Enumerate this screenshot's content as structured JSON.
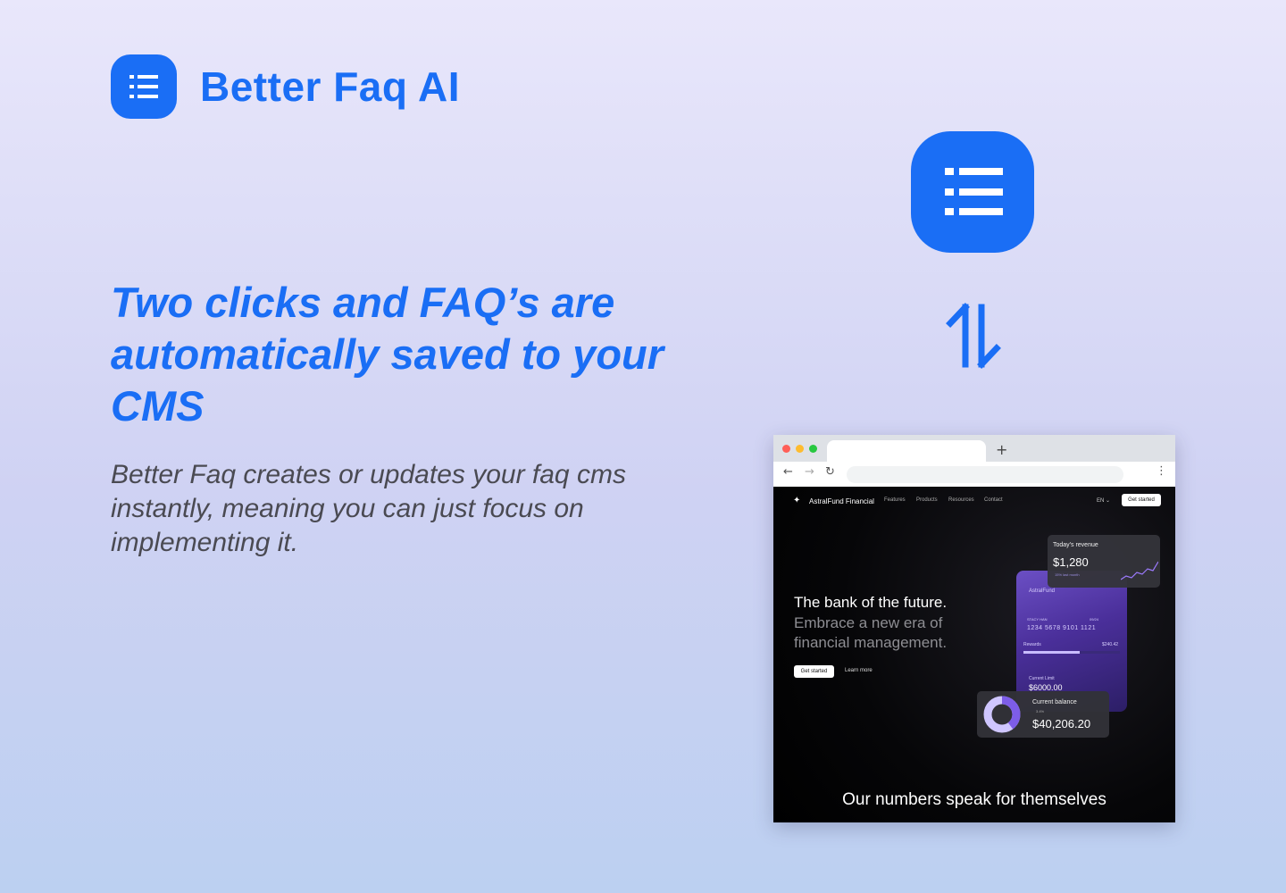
{
  "brand": {
    "name": "Better Faq AI",
    "icon": "list-icon",
    "color": "#1a6ef5"
  },
  "headline": "Two clicks and FAQ’s are automatically saved to your CMS",
  "subtext": "Better Faq creates or updates your faq cms instantly, meaning you can just focus on implementing it.",
  "sync_icon": "swap-vertical-arrows-icon",
  "browser": {
    "new_tab": "+",
    "site": {
      "name": "AstralFund Financial",
      "nav": [
        "Features",
        "Products",
        "Resources",
        "Contact"
      ],
      "lang": "EN ⌄",
      "cta": "Get started",
      "hero_title": "The bank of the future.",
      "hero_sub": "Embrace a new era of financial management.",
      "hero_button": "Get started",
      "hero_link": "Learn more",
      "revenue": {
        "label": "Today's revenue",
        "value": "$1,280",
        "change": "15% last month"
      },
      "card": {
        "brand": "AstralFund",
        "holder": "STACY HAN",
        "expiry": "09/24",
        "number": "1234 5678 9101 1121",
        "rewards_label": "Rewards",
        "rewards_value": "$240.42",
        "limit_label": "Current Limit",
        "limit_value": "$6000.00"
      },
      "balance": {
        "label": "Current balance",
        "change": "3.4%",
        "value": "$40,206.20"
      },
      "footer_title": "Our numbers speak for themselves"
    }
  }
}
